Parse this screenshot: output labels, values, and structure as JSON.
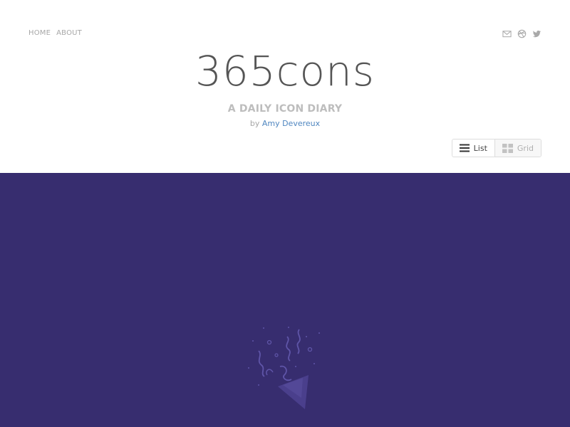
{
  "nav": {
    "home": "HOME",
    "about": "ABOUT"
  },
  "social": {
    "icons": [
      "mail-icon",
      "dribbble-icon",
      "twitter-icon"
    ]
  },
  "site": {
    "title": "365cons",
    "tagline": "A DAILY ICON DIARY",
    "by_prefix": "by",
    "author": "Amy Devereux"
  },
  "view_toggle": {
    "list_label": "List",
    "grid_label": "Grid",
    "selected": "List"
  },
  "colors": {
    "hero_background": "#372d6f",
    "accent_link": "#4f86c0",
    "logo_text": "#555555",
    "muted_text": "#a7a7a7"
  },
  "hero": {
    "illustration_icon": "party-popper-icon"
  }
}
